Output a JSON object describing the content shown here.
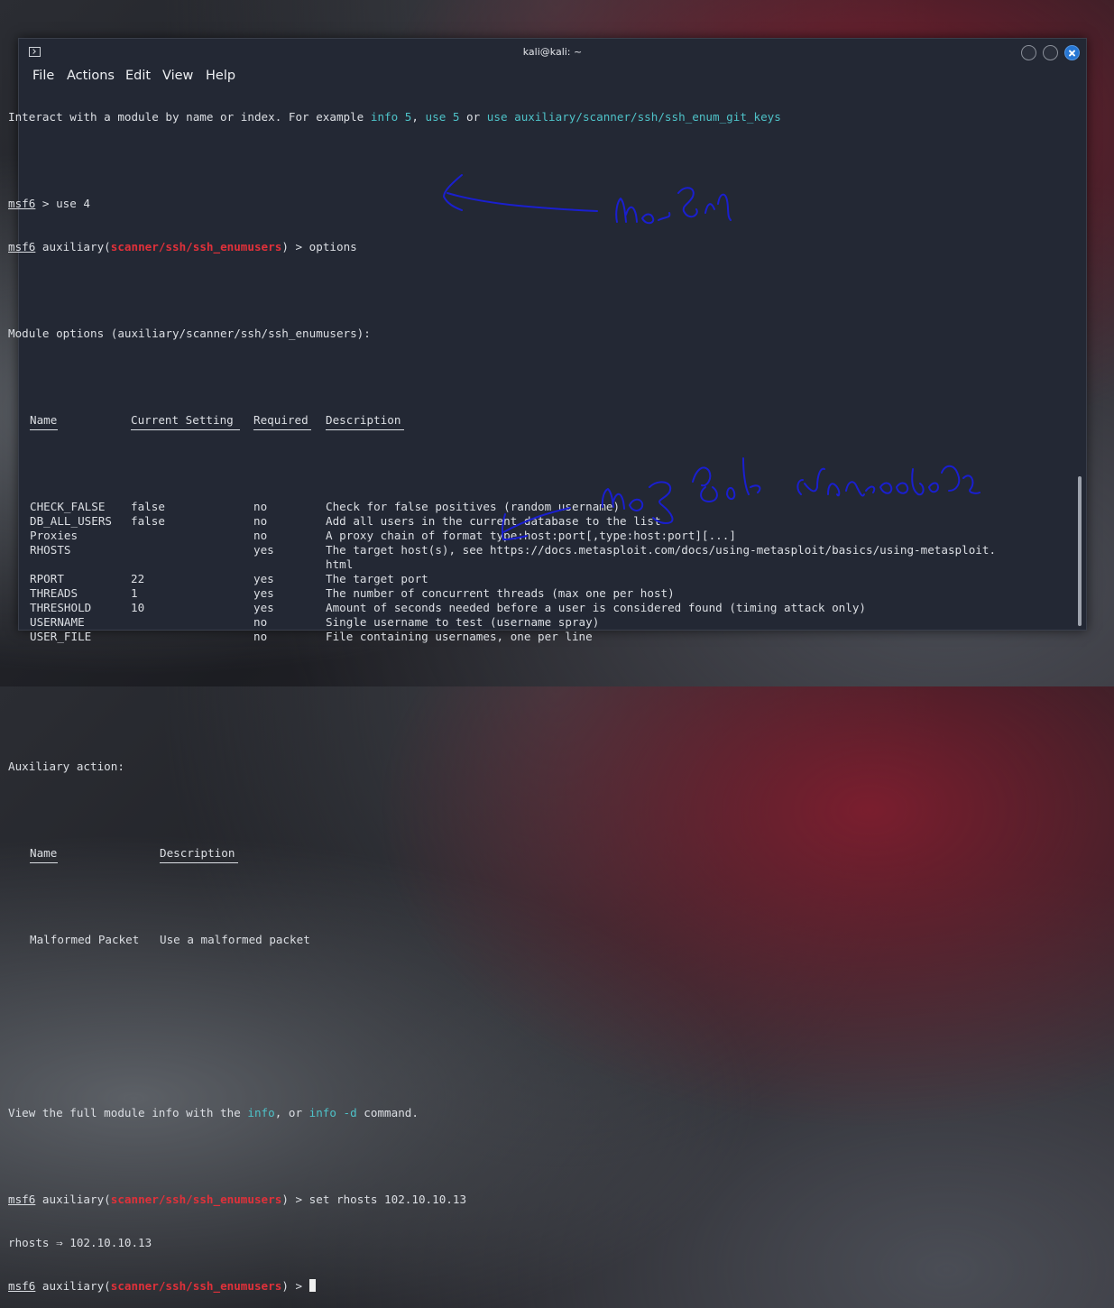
{
  "window": {
    "title": "kali@kali: ~",
    "menu": [
      "File",
      "Actions",
      "Edit",
      "View",
      "Help"
    ]
  },
  "terminal": {
    "intro": {
      "text": "Interact with a module by name or index. For example ",
      "link1": "info 5",
      "sep1": ", ",
      "link2": "use 5",
      "sep2": " or ",
      "link3": "use auxiliary/scanner/ssh/ssh_enum_git_keys"
    },
    "prompt": "msf6",
    "cmd1": " > use 4",
    "module_prefix": " auxiliary(",
    "module_name": "scanner/ssh/ssh_enumusers",
    "module_suffix": ") > ",
    "cmd2": "options",
    "module_options_title": "Module options (auxiliary/scanner/ssh/ssh_enumusers):",
    "options_headers": [
      "Name",
      "Current Setting",
      "Required",
      "Description"
    ],
    "options_rows": [
      [
        "CHECK_FALSE",
        "false",
        "no",
        "Check for false positives (random username)"
      ],
      [
        "DB_ALL_USERS",
        "false",
        "no",
        "Add all users in the current database to the list"
      ],
      [
        "Proxies",
        "",
        "no",
        "A proxy chain of format type:host:port[,type:host:port][...]"
      ],
      [
        "RHOSTS",
        "",
        "yes",
        "The target host(s), see https://docs.metasploit.com/docs/using-metasploit/basics/using-metasploit."
      ],
      [
        "",
        "",
        "",
        "html"
      ],
      [
        "RPORT",
        "22",
        "yes",
        "The target port"
      ],
      [
        "THREADS",
        "1",
        "yes",
        "The number of concurrent threads (max one per host)"
      ],
      [
        "THRESHOLD",
        "10",
        "yes",
        "Amount of seconds needed before a user is considered found (timing attack only)"
      ],
      [
        "USERNAME",
        "",
        "no",
        "Single username to test (username spray)"
      ],
      [
        "USER_FILE",
        "",
        "no",
        "File containing usernames, one per line"
      ]
    ],
    "aux_title": "Auxiliary action:",
    "aux_headers": [
      "Name",
      "Description"
    ],
    "aux_rows": [
      [
        "Malformed Packet",
        "Use a malformed packet"
      ]
    ],
    "view_info": {
      "text": "View the full module info with the ",
      "link1": "info",
      "sep": ", or ",
      "link2": "info -d",
      "end": " command."
    },
    "cmd3": "set rhosts 102.10.10.13",
    "rhosts_result": "rhosts ⇒ 102.10.10.13"
  },
  "colors": {
    "terminal_bg": "#232834",
    "prompt_red": "#e0313a",
    "link_cyan": "#4ec2c8",
    "annotation_blue": "#1a1fd0",
    "close_button": "#2777d4"
  }
}
